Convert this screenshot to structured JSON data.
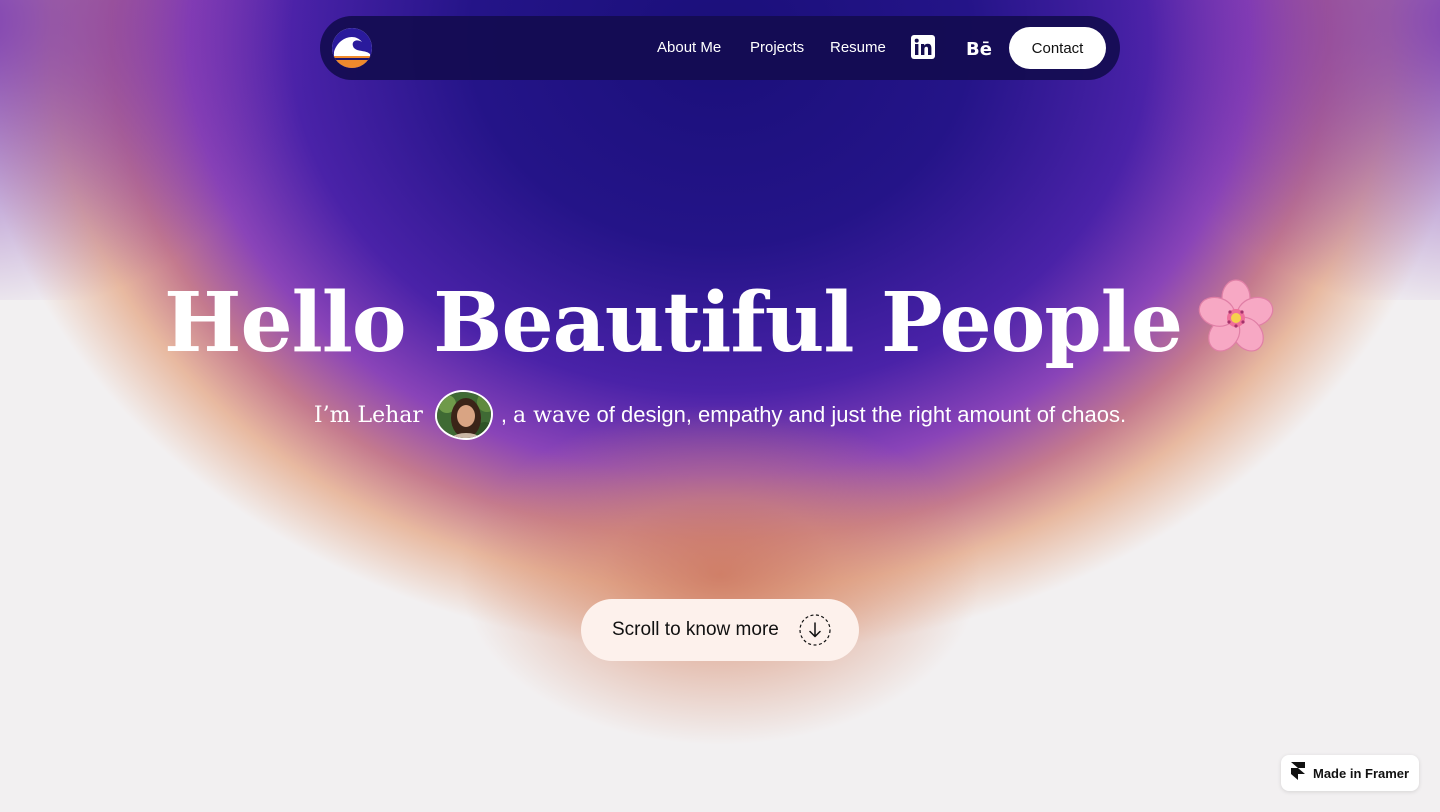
{
  "nav": {
    "logo_icon": "wave-logo-icon",
    "links": [
      {
        "label": "About Me"
      },
      {
        "label": "Projects"
      },
      {
        "label": "Resume"
      }
    ],
    "social": [
      {
        "icon": "linkedin-icon"
      },
      {
        "icon": "behance-icon"
      }
    ],
    "contact_label": "Contact"
  },
  "hero": {
    "title": "Hello Beautiful People",
    "title_icon": "cherry-blossom-icon",
    "intro_name": "I’m Lehar",
    "intro_avatar_icon": "avatar",
    "intro_pre": ",",
    "intro_wave": "a wave",
    "intro_rest": "of design, empathy and just the right amount of chaos."
  },
  "scroll": {
    "label": "Scroll to know more",
    "icon": "arrow-down-icon"
  },
  "badge": {
    "label": "Made in Framer",
    "icon": "framer-icon"
  },
  "colors": {
    "nav_bg": "#140c50",
    "accent_purple": "#241488",
    "peach": "#d9886a",
    "button_bg": "#fdf1ec"
  }
}
